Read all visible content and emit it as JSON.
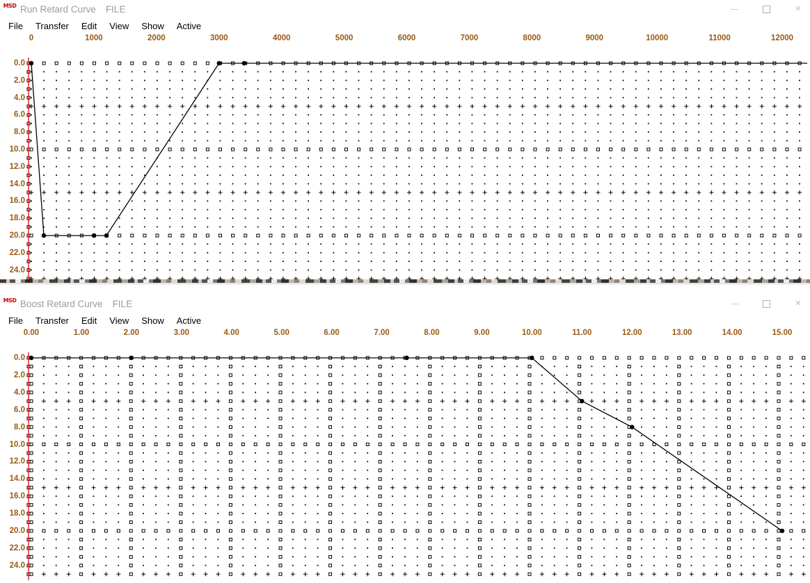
{
  "windows": [
    {
      "id": "run-retard",
      "title": "Run Retard Curve",
      "file_label": "FILE",
      "icon": "msd-logo-icon",
      "controls": {
        "minimize": "minimize-icon",
        "maximize": "maximize-icon",
        "close": "close-icon"
      },
      "menu": [
        "File",
        "Transfer",
        "Edit",
        "View",
        "Show",
        "Active"
      ],
      "chart_data": {
        "type": "line",
        "title": "Run Retard Curve",
        "xlabel": "",
        "ylabel": "",
        "xlim": [
          0,
          12400
        ],
        "ylim": [
          0,
          25
        ],
        "y_inverted": true,
        "grid": true,
        "legend": "none",
        "xticks": [
          0,
          1000,
          2000,
          3000,
          4000,
          5000,
          6000,
          7000,
          8000,
          9000,
          10000,
          11000,
          12000
        ],
        "xticklabels": [
          "0",
          "1000",
          "2000",
          "3000",
          "4000",
          "5000",
          "6000",
          "7000",
          "8000",
          "9000",
          "10000",
          "11000",
          "12000"
        ],
        "yticks": [
          0,
          2,
          4,
          6,
          8,
          10,
          12,
          14,
          16,
          18,
          20,
          22,
          24
        ],
        "yticklabels": [
          "0.0",
          "2.0",
          "4.0",
          "6.0",
          "8.0",
          "10.0",
          "12.0",
          "14.0",
          "16.0",
          "18.0",
          "20.0",
          "22.0",
          "24.0"
        ],
        "x": [
          0,
          200,
          600,
          1000,
          1200,
          3000,
          3400,
          12400
        ],
        "y": [
          0,
          20,
          20,
          20,
          20,
          0,
          0,
          0
        ],
        "markers": [
          {
            "x": 0,
            "y": 0
          },
          {
            "x": 200,
            "y": 20
          },
          {
            "x": 1000,
            "y": 20
          },
          {
            "x": 1200,
            "y": 20
          },
          {
            "x": 3000,
            "y": 0
          },
          {
            "x": 3400,
            "y": 0
          }
        ],
        "series": [
          {
            "name": "retard",
            "values": [
              0,
              20,
              20,
              20,
              20,
              0,
              0,
              0
            ]
          }
        ]
      }
    },
    {
      "id": "boost-retard",
      "title": "Boost Retard Curve",
      "file_label": "FILE",
      "icon": "msd-logo-icon",
      "controls": {
        "minimize": "minimize-icon",
        "maximize": "maximize-icon",
        "close": "close-icon"
      },
      "menu": [
        "File",
        "Transfer",
        "Edit",
        "View",
        "Show",
        "Active"
      ],
      "chart_data": {
        "type": "line",
        "title": "Boost Retard Curve",
        "xlabel": "",
        "ylabel": "",
        "xlim": [
          0,
          15.5
        ],
        "ylim": [
          0,
          25
        ],
        "y_inverted": true,
        "grid": true,
        "legend": "none",
        "xticks": [
          0,
          1,
          2,
          3,
          4,
          5,
          6,
          7,
          8,
          9,
          10,
          11,
          12,
          13,
          14,
          15
        ],
        "xticklabels": [
          "0.00",
          "1.00",
          "2.00",
          "3.00",
          "4.00",
          "5.00",
          "6.00",
          "7.00",
          "8.00",
          "9.00",
          "10.00",
          "11.00",
          "12.00",
          "13.00",
          "14.00",
          "15.00"
        ],
        "yticks": [
          0,
          2,
          4,
          6,
          8,
          10,
          12,
          14,
          16,
          18,
          20,
          22,
          24
        ],
        "yticklabels": [
          "0.0",
          "2.0",
          "4.0",
          "6.0",
          "8.0",
          "10.0",
          "12.0",
          "14.0",
          "16.0",
          "18.0",
          "20.0",
          "22.0",
          "24.0"
        ],
        "x": [
          0,
          2,
          7.5,
          10,
          11,
          12,
          15
        ],
        "y": [
          0,
          0,
          0,
          0,
          5,
          8,
          20
        ],
        "markers": [
          {
            "x": 0,
            "y": 0
          },
          {
            "x": 2,
            "y": 0
          },
          {
            "x": 7.5,
            "y": 0
          },
          {
            "x": 10,
            "y": 0
          },
          {
            "x": 11,
            "y": 5
          },
          {
            "x": 12,
            "y": 8
          },
          {
            "x": 15,
            "y": 20
          }
        ],
        "series": [
          {
            "name": "boost retard",
            "values": [
              0,
              0,
              0,
              0,
              5,
              8,
              20
            ]
          }
        ]
      }
    }
  ],
  "colors": {
    "tick_label": "#9a5a15",
    "axis_red": "#e02020",
    "curve": "#000000",
    "grid": "#000000",
    "title_text": "#9b9b9b",
    "menu_text": "#000000",
    "logo_red": "#cc0000"
  }
}
